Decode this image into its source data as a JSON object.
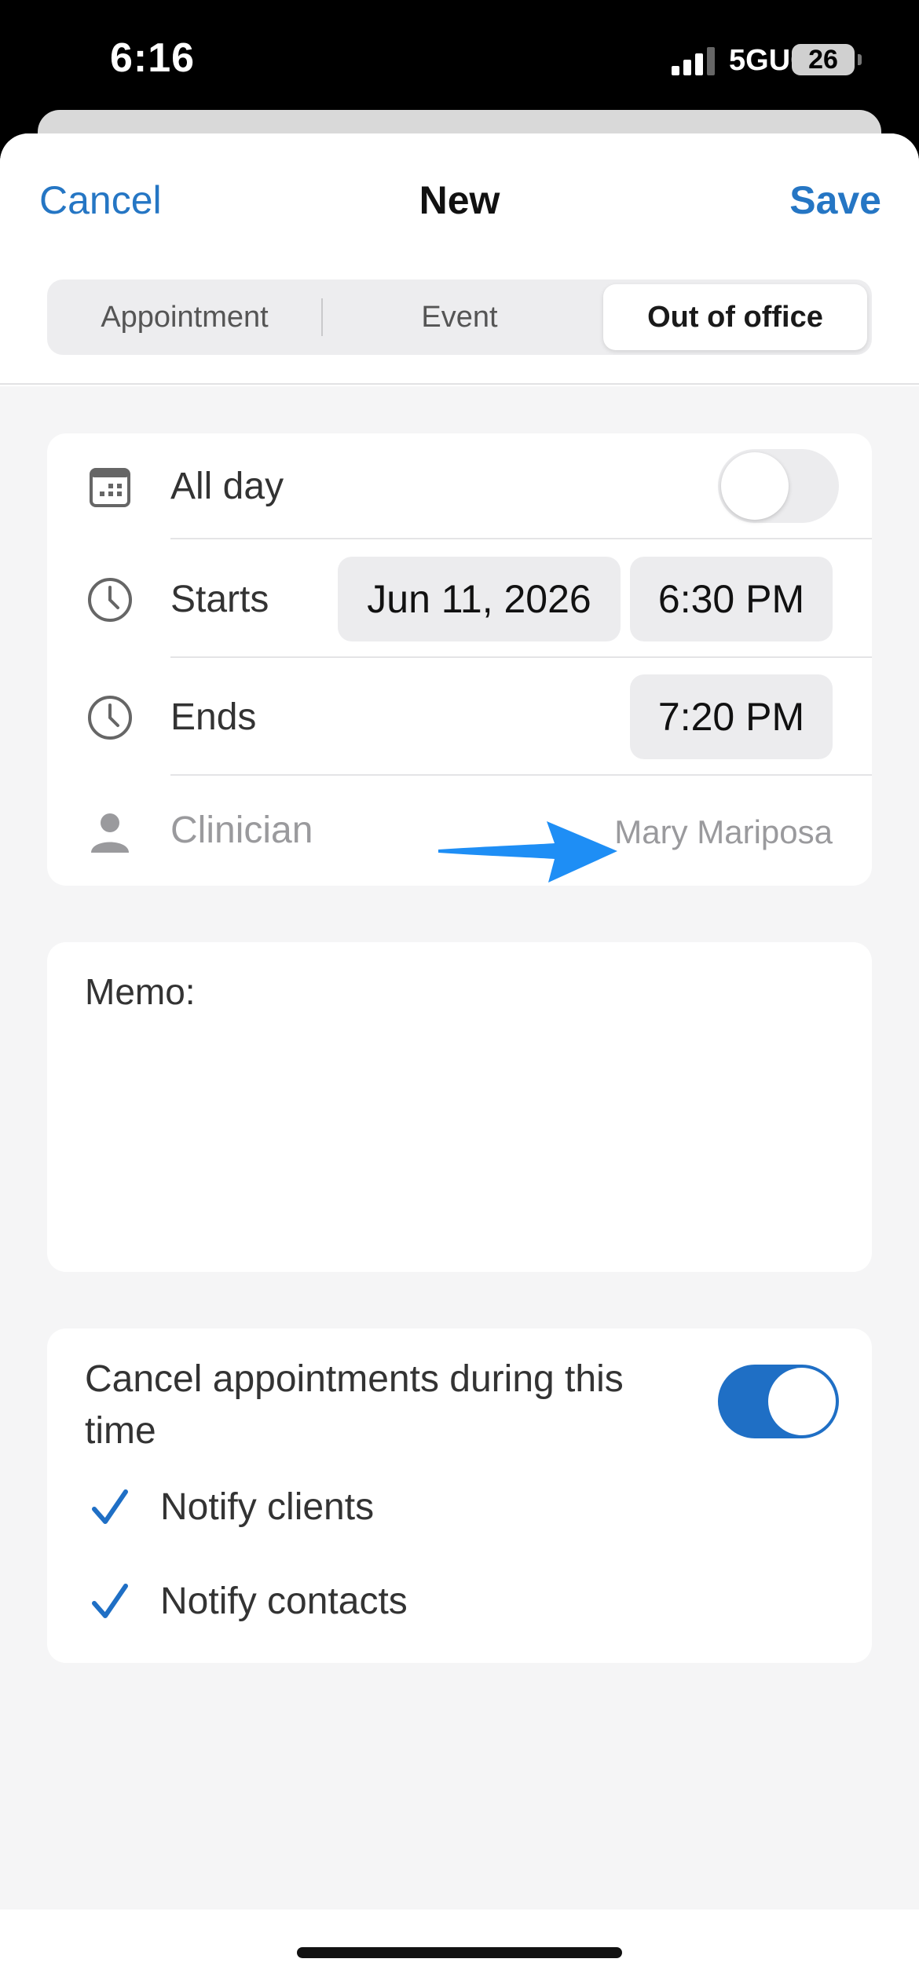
{
  "status_bar": {
    "time": "6:16",
    "network": "5GUC",
    "battery": "26"
  },
  "nav": {
    "cancel_label": "Cancel",
    "title": "New",
    "save_label": "Save"
  },
  "segments": {
    "items": [
      "Appointment",
      "Event",
      "Out of office"
    ],
    "selected": "Out of office"
  },
  "schedule": {
    "all_day_label": "All day",
    "all_day_on": false,
    "starts_label": "Starts",
    "start_date": "Jun 11, 2026",
    "start_time": "6:30 PM",
    "ends_label": "Ends",
    "end_time": "7:20 PM",
    "clinician_label": "Clinician",
    "clinician_value": "Mary Mariposa"
  },
  "memo": {
    "label": "Memo:"
  },
  "cancel_section": {
    "label": "Cancel appointments during this time",
    "toggle_on": true,
    "notify_clients_label": "Notify clients",
    "notify_contacts_label": "Notify contacts"
  },
  "colors": {
    "accent": "#2576c4",
    "toggle_on": "#1f6fc5",
    "arrow": "#1e8ef5"
  }
}
